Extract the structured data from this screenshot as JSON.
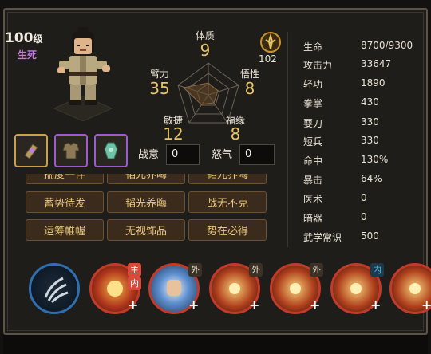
{
  "hero": {
    "level": "100",
    "level_unit": "级",
    "realm": "生死",
    "power": "102"
  },
  "radar": {
    "attrs": [
      {
        "label": "体质",
        "value": "9"
      },
      {
        "label": "悟性",
        "value": "8"
      },
      {
        "label": "福缘",
        "value": "8"
      },
      {
        "label": "敏捷",
        "value": "12"
      },
      {
        "label": "臂力",
        "value": "35"
      }
    ]
  },
  "gauges": {
    "battle_will_label": "战意",
    "battle_will_value": "0",
    "rage_label": "怒气",
    "rage_value": "0"
  },
  "tags": {
    "row1": [
      "揣度一伴",
      "韬光养晦",
      "韬光养晦"
    ],
    "row2": [
      "蓄势待发",
      "韬光养晦",
      "战无不克"
    ],
    "row3": [
      "运筹帷幄",
      "无视饰品",
      "势在必得"
    ]
  },
  "stats": [
    {
      "label": "生命",
      "value": "8700/9300"
    },
    {
      "label": "攻击力",
      "value": "33647"
    },
    {
      "label": "轻功",
      "value": "1890"
    },
    {
      "label": "拳掌",
      "value": "430"
    },
    {
      "label": "耍刀",
      "value": "330"
    },
    {
      "label": "短兵",
      "value": "330"
    },
    {
      "label": "命中",
      "value": "130%"
    },
    {
      "label": "暴击",
      "value": "64%"
    },
    {
      "label": "医术",
      "value": "0"
    },
    {
      "label": "暗器",
      "value": "0"
    },
    {
      "label": "武学常识",
      "value": "500"
    }
  ],
  "skills": {
    "tags": [
      "主",
      "内",
      "外",
      "外",
      "外",
      "内"
    ]
  },
  "colors": {
    "gold": "#e7c667",
    "realm": "#c07be6",
    "tag_text": "#e8c77c",
    "internal": "#4fb6e0",
    "main_tag": "#d94a3a"
  }
}
